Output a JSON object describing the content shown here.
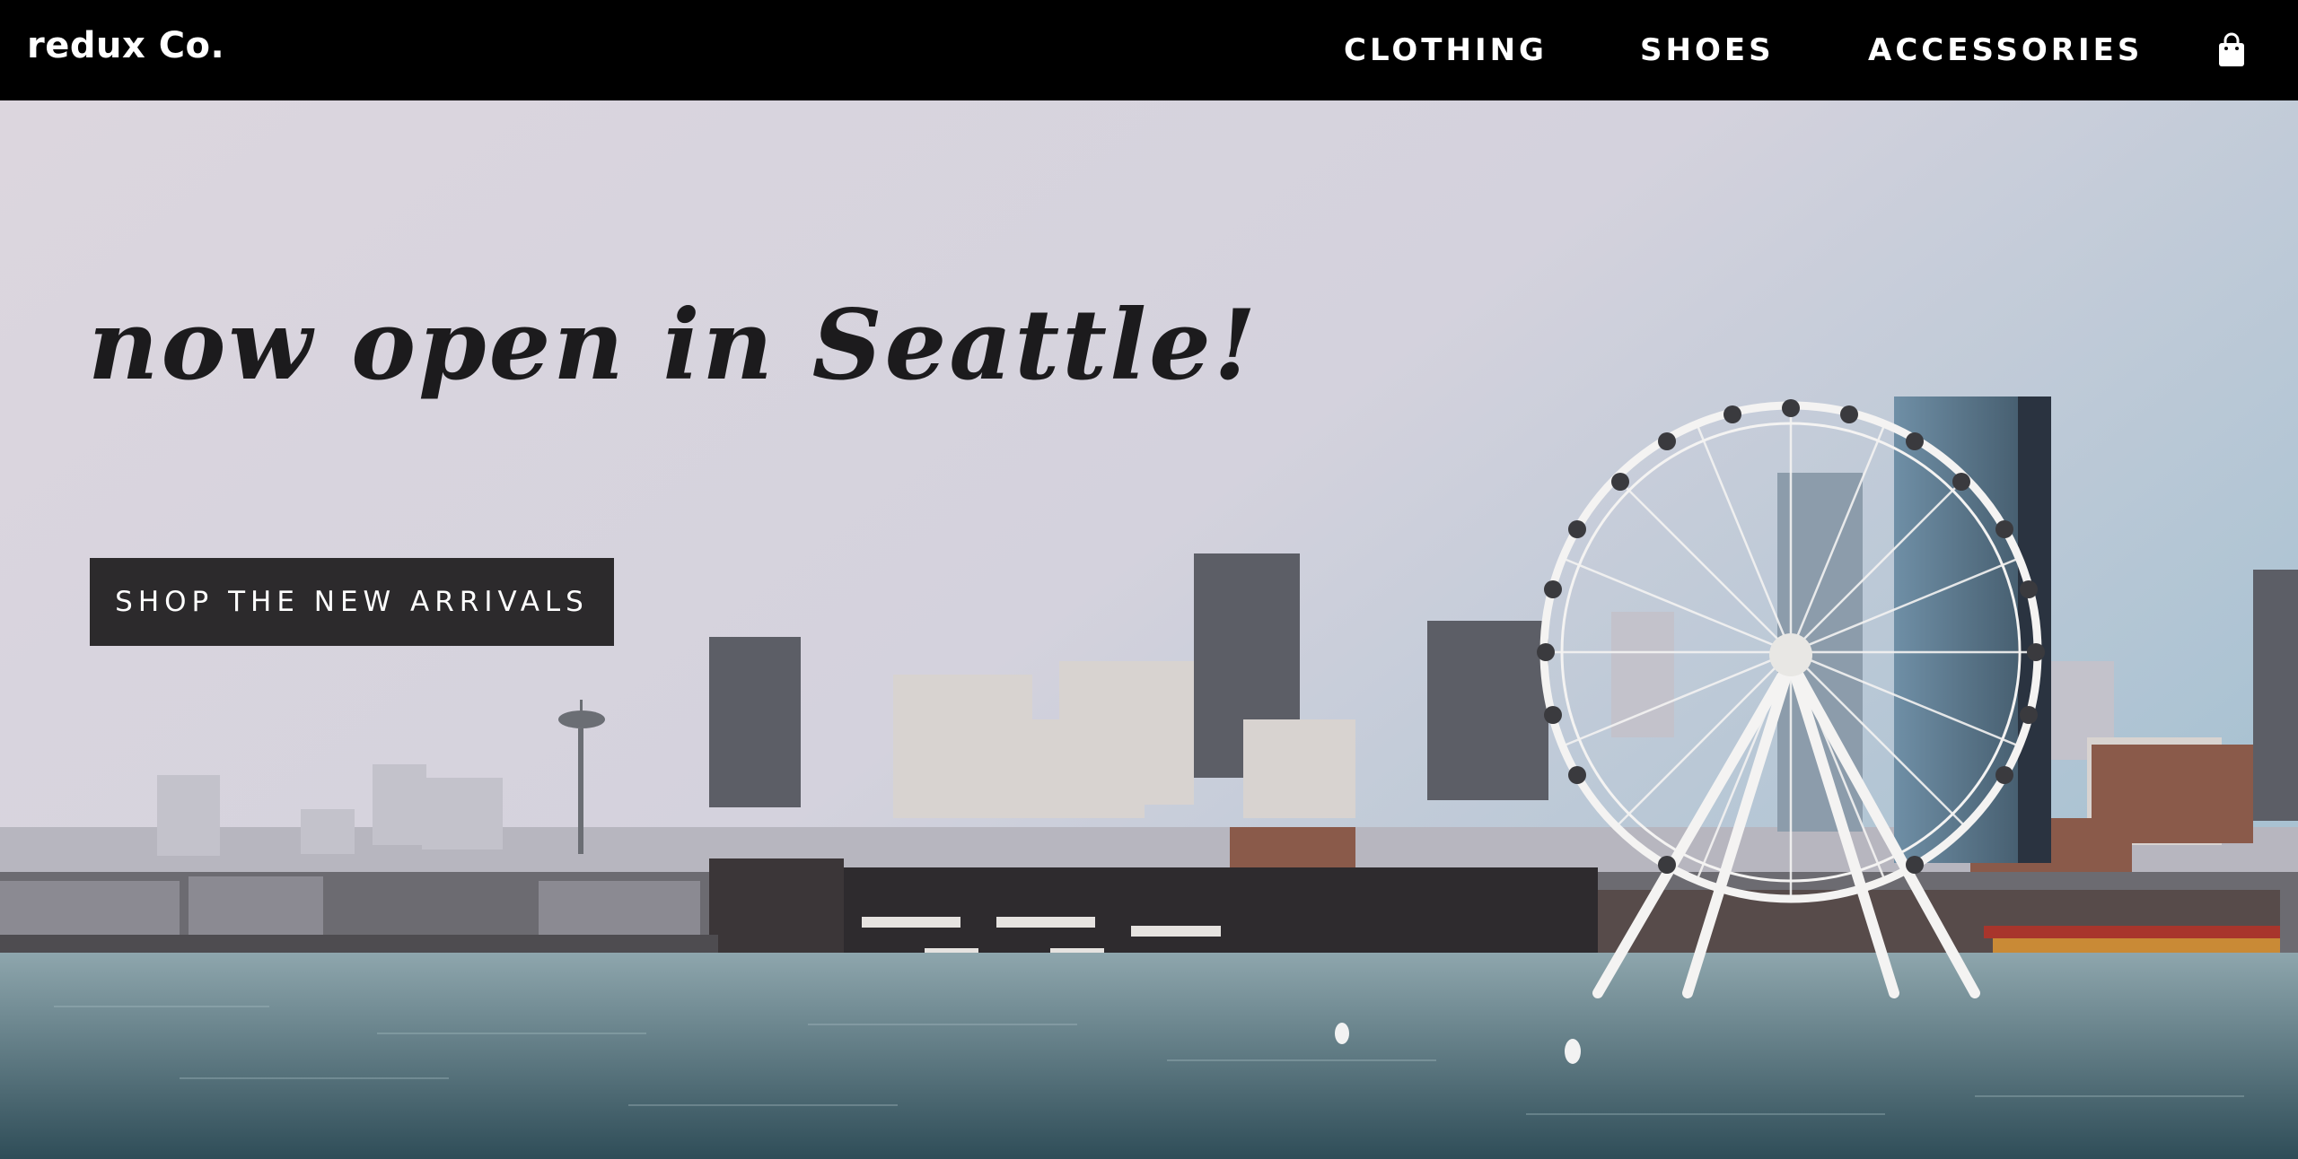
{
  "brand": {
    "logo_text": "redux Co."
  },
  "nav": {
    "items": [
      {
        "label": "CLOTHING"
      },
      {
        "label": "SHOES"
      },
      {
        "label": "ACCESSORIES"
      }
    ],
    "cart_icon": "shopping-bag-icon"
  },
  "hero": {
    "headline": "now open in Seattle!",
    "cta_label": "SHOP THE NEW ARRIVALS",
    "image_subject": "Seattle waterfront skyline with Great Wheel, Space Needle and aquarium pier"
  },
  "colors": {
    "nav_bg": "#000000",
    "nav_text": "#ffffff",
    "headline": "#1c1b1d",
    "cta_bg": "#2c2a2c",
    "cta_text": "#ffffff"
  }
}
